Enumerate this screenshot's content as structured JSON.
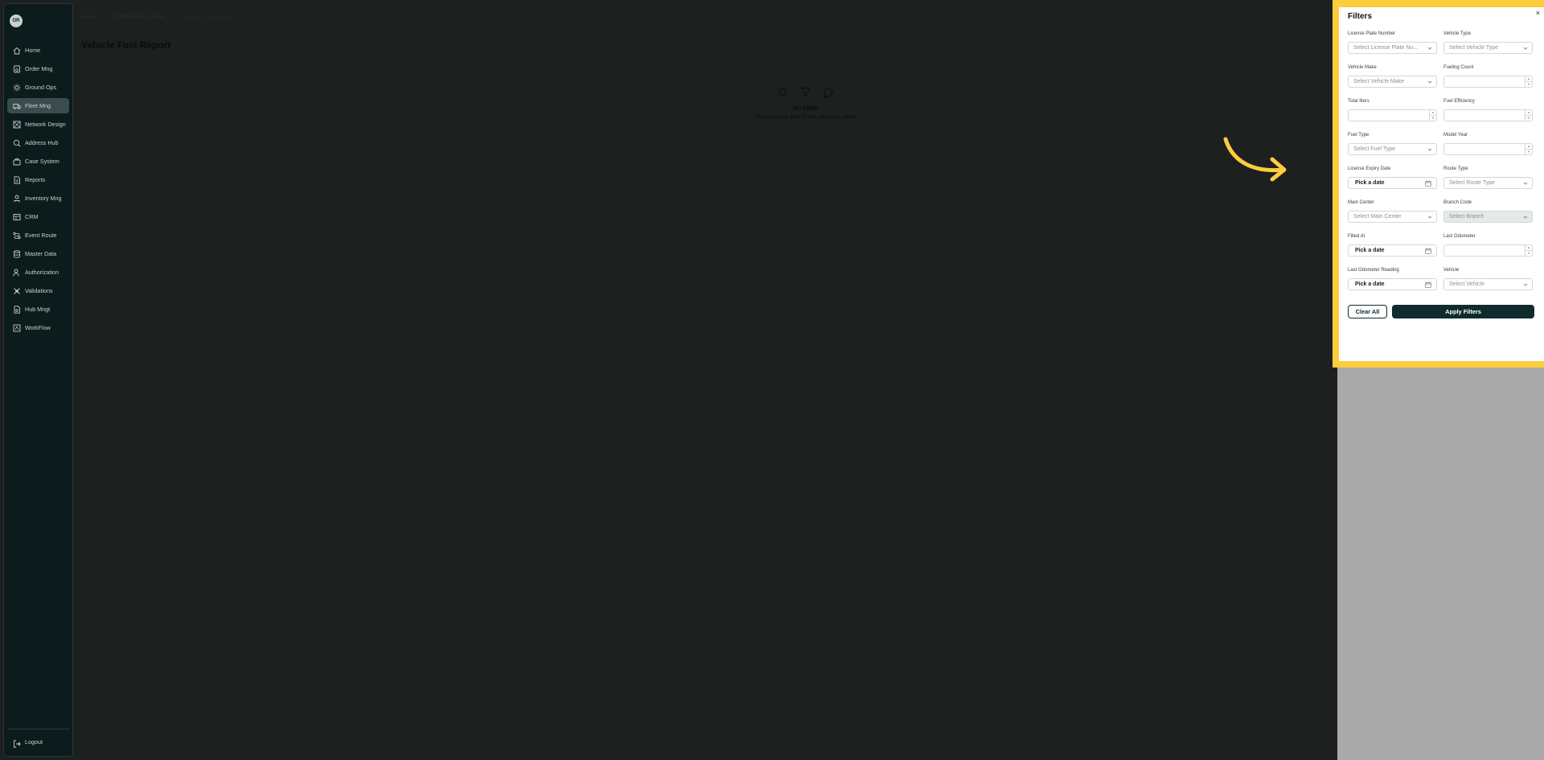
{
  "sidebar": {
    "avatar_text": "OR",
    "items": [
      {
        "label": "Home",
        "icon": "home-icon"
      },
      {
        "label": "Order Mng",
        "icon": "order-icon"
      },
      {
        "label": "Ground Ops",
        "icon": "ground-ops-icon"
      },
      {
        "label": "Fleet Mng",
        "icon": "fleet-icon"
      },
      {
        "label": "Network Design",
        "icon": "network-icon"
      },
      {
        "label": "Address Hub",
        "icon": "address-icon"
      },
      {
        "label": "Case System",
        "icon": "case-icon"
      },
      {
        "label": "Reports",
        "icon": "reports-icon"
      },
      {
        "label": "Inventory Mng",
        "icon": "inventory-icon"
      },
      {
        "label": "CRM",
        "icon": "crm-icon"
      },
      {
        "label": "Event Route",
        "icon": "route-icon"
      },
      {
        "label": "Master Data",
        "icon": "database-icon"
      },
      {
        "label": "Authorization",
        "icon": "user-icon"
      },
      {
        "label": "Validations",
        "icon": "validation-icon"
      },
      {
        "label": "Hub Mngt",
        "icon": "hub-icon"
      },
      {
        "label": "WorkFlow",
        "icon": "workflow-icon"
      }
    ],
    "active_index": 3,
    "logout_label": "Logout"
  },
  "breadcrumb": [
    "Home",
    "Fleet Management",
    "Vehicle Fuel Report"
  ],
  "page_title": "Vehicle Fuel Report",
  "empty_state": {
    "title": "No Filter",
    "subtitle": "Please choose filter for the data to be shown"
  },
  "filters": {
    "title": "Filters",
    "close_glyph": "×",
    "fields": {
      "license_plate": {
        "label": "License Plate Number",
        "placeholder": "Select License Plate Nu..."
      },
      "vehicle_type": {
        "label": "Vehicle Type",
        "placeholder": "Select Vehicle Type"
      },
      "vehicle_make": {
        "label": "Vehicle Make",
        "placeholder": "Select Vehicle Make"
      },
      "fueling_count": {
        "label": "Fueling Count",
        "value": ""
      },
      "total_liters": {
        "label": "Total liters",
        "value": ""
      },
      "fuel_efficiency": {
        "label": "Fuel Efficiency",
        "value": ""
      },
      "fuel_type": {
        "label": "Fuel Type",
        "placeholder": "Select Fuel Type"
      },
      "model_year": {
        "label": "Model Year",
        "value": ""
      },
      "license_expiry": {
        "label": "License Expiry Date",
        "placeholder": "Pick a date"
      },
      "route_type": {
        "label": "Route Type",
        "placeholder": "Select Route Type"
      },
      "main_center": {
        "label": "Main Center",
        "placeholder": "Select Main Center"
      },
      "branch_code": {
        "label": "Branch Code",
        "placeholder": "Select Branch"
      },
      "filled_at": {
        "label": "Filled At",
        "placeholder": "Pick a date"
      },
      "last_odometer": {
        "label": "Last Odometer",
        "value": ""
      },
      "last_odometer_reading": {
        "label": "Last Odometer Reading",
        "placeholder": "Pick a date"
      },
      "vehicle": {
        "label": "Vehicle",
        "placeholder": "Select Vehicle"
      }
    },
    "clear_label": "Clear All",
    "apply_label": "Apply Filters"
  },
  "colors": {
    "highlight": "#fccd3c",
    "primary": "#0f2b2d",
    "sidebar_bg": "#0c1b1c"
  }
}
